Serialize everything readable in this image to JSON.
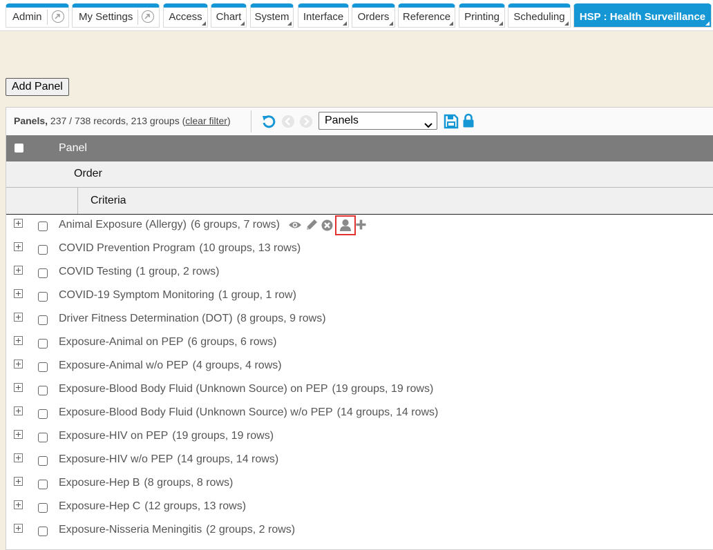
{
  "tabs": [
    {
      "label": "Admin"
    },
    {
      "label": "My Settings"
    },
    {
      "label": "Access"
    },
    {
      "label": "Chart"
    },
    {
      "label": "System"
    },
    {
      "label": "Interface"
    },
    {
      "label": "Orders"
    },
    {
      "label": "Reference"
    },
    {
      "label": "Printing"
    },
    {
      "label": "Scheduling"
    },
    {
      "label": "HSP : Health Surveillance",
      "active": true
    }
  ],
  "add_panel_label": "Add Panel",
  "toolbar": {
    "title": "Panels,",
    "summary": "237 / 738 records, 213 groups (",
    "clear_filter": "clear filter",
    "close_paren": ")",
    "view_select": "Panels"
  },
  "headers": {
    "level1": "Panel",
    "level2": "Order",
    "level3": "Criteria"
  },
  "rows": [
    {
      "name": "Animal Exposure (Allergy)",
      "count": "(6 groups, 7 rows)"
    },
    {
      "name": "COVID Prevention Program",
      "count": "(10 groups, 13 rows)"
    },
    {
      "name": "COVID Testing",
      "count": "(1 group, 2 rows)"
    },
    {
      "name": "COVID-19 Symptom Monitoring",
      "count": "(1 group, 1 row)"
    },
    {
      "name": "Driver Fitness Determination (DOT)",
      "count": "(8 groups, 9 rows)"
    },
    {
      "name": "Exposure-Animal on PEP",
      "count": "(6 groups, 6 rows)"
    },
    {
      "name": "Exposure-Animal w/o PEP",
      "count": "(4 groups, 4 rows)"
    },
    {
      "name": "Exposure-Blood Body Fluid (Unknown Source) on PEP",
      "count": "(19 groups, 19 rows)"
    },
    {
      "name": "Exposure-Blood Body Fluid (Unknown Source) w/o PEP",
      "count": "(14 groups, 14 rows)"
    },
    {
      "name": "Exposure-HIV on PEP",
      "count": "(19 groups, 19 rows)"
    },
    {
      "name": "Exposure-HIV w/o PEP",
      "count": "(14 groups, 14 rows)"
    },
    {
      "name": "Exposure-Hep B",
      "count": "(8 groups, 8 rows)"
    },
    {
      "name": "Exposure-Hep C",
      "count": "(12 groups, 13 rows)"
    },
    {
      "name": "Exposure-Nisseria Meningitis",
      "count": "(2 groups, 2 rows)"
    }
  ],
  "row_action_icons": [
    "eye-icon",
    "pencil-icon",
    "remove-icon",
    "user-icon",
    "plus-icon"
  ],
  "colors": {
    "accent": "#1597d6",
    "page_background": "#f4eee0",
    "header_gray": "#7c7c7c",
    "highlight": "#e03030"
  }
}
